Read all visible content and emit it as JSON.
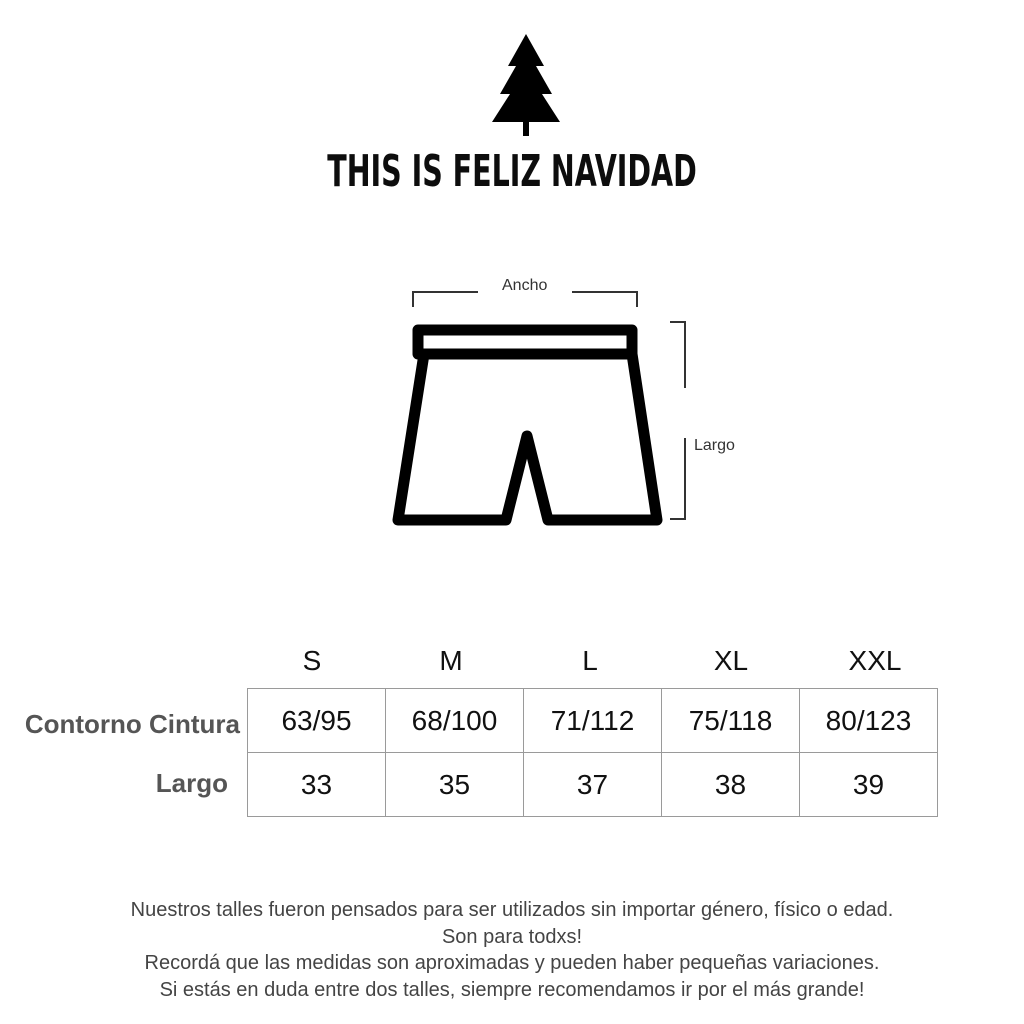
{
  "brand": {
    "logo_icon": "pine-tree-icon",
    "title": "THIS IS FELIZ NAVIDAD"
  },
  "diagram": {
    "icon": "shorts-icon",
    "width_label": "Ancho",
    "length_label": "Largo"
  },
  "size_table": {
    "sizes": [
      "S",
      "M",
      "L",
      "XL",
      "XXL"
    ],
    "rows": [
      {
        "label": "Contorno Cintura",
        "values": [
          "63/95",
          "68/100",
          "71/112",
          "75/118",
          "80/123"
        ]
      },
      {
        "label": "Largo",
        "values": [
          "33",
          "35",
          "37",
          "38",
          "39"
        ]
      }
    ]
  },
  "notes": [
    "Nuestros talles fueron pensados para ser utilizados sin importar género, físico o edad.",
    "Son para todxs!",
    "Recordá que las medidas son aproximadas y pueden haber pequeñas variaciones.",
    "Si estás en duda entre dos talles, siempre recomendamos ir por el más grande!"
  ]
}
